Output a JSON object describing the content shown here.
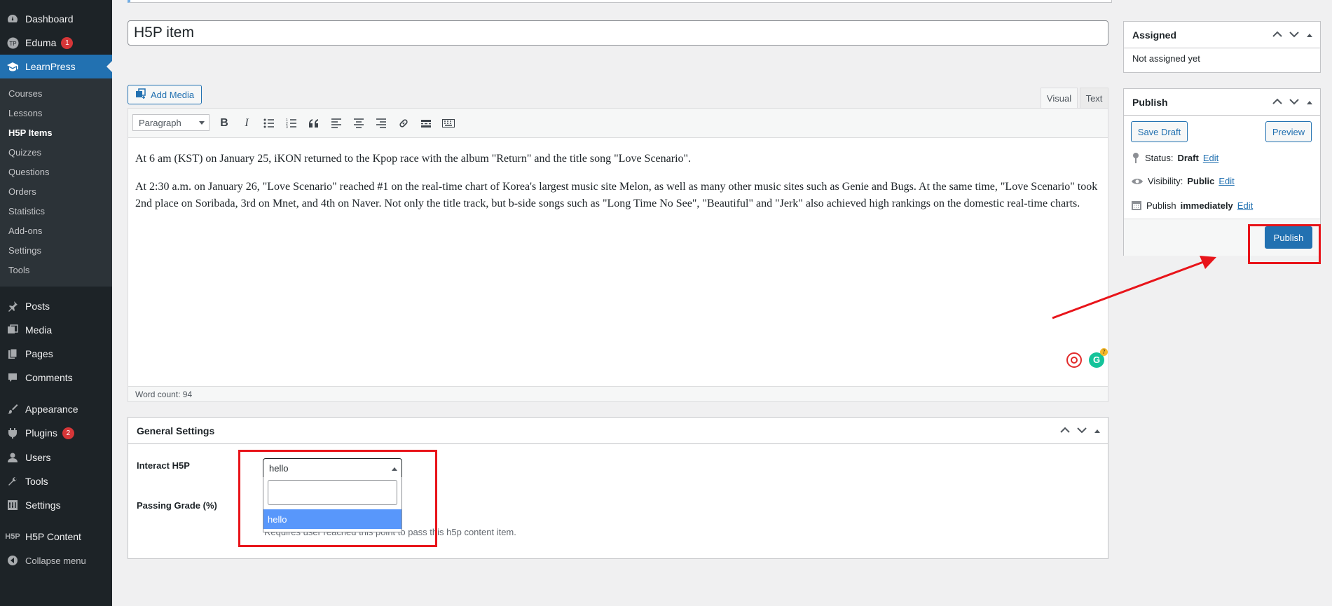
{
  "sidebar": {
    "top": [
      {
        "label": "Dashboard",
        "icon": "dashboard-icon"
      },
      {
        "label": "Eduma",
        "icon": "eduma-icon",
        "badge": "1"
      },
      {
        "label": "LearnPress",
        "icon": "graduation-cap-icon"
      }
    ],
    "submenu": [
      "Courses",
      "Lessons",
      "H5P Items",
      "Quizzes",
      "Questions",
      "Orders",
      "Statistics",
      "Add-ons",
      "Settings",
      "Tools"
    ],
    "bottom": [
      {
        "label": "Posts",
        "icon": "pin-icon"
      },
      {
        "label": "Media",
        "icon": "media-icon"
      },
      {
        "label": "Pages",
        "icon": "pages-icon"
      },
      {
        "label": "Comments",
        "icon": "comments-icon"
      },
      {
        "label": "Appearance",
        "icon": "brush-icon"
      },
      {
        "label": "Plugins",
        "icon": "plugin-icon",
        "badge": "2"
      },
      {
        "label": "Users",
        "icon": "users-icon"
      },
      {
        "label": "Tools",
        "icon": "wrench-icon"
      },
      {
        "label": "Settings",
        "icon": "settings-icon"
      },
      {
        "label": "H5P Content",
        "icon": "h5p-icon",
        "icon_text": "H5P"
      },
      {
        "label": "Collapse menu",
        "icon": "collapse-icon"
      }
    ]
  },
  "editor": {
    "title": "H5P item",
    "add_media": "Add Media",
    "tab_visual": "Visual",
    "tab_text": "Text",
    "format": "Paragraph",
    "paragraphs": [
      "At 6 am (KST) on January 25, iKON returned to the Kpop race with the album \"Return\" and the title song \"Love Scenario\".",
      "At 2:30 a.m. on January 26, \"Love Scenario\" reached #1 on the real-time chart of Korea's largest music site Melon, as well as many other music sites such as Genie and Bugs. At the same time, \"Love Scenario\" took 2nd place on Soribada, 3rd on Mnet, and 4th on Naver. Not only the title track, but b-side songs such as \"Long Time No See\", \"Beautiful\" and \"Jerk\" also achieved high rankings on the domestic real-time charts."
    ],
    "word_count": "Word count: 94",
    "grammarly_badge": "7"
  },
  "assigned": {
    "title": "Assigned",
    "text": "Not assigned yet"
  },
  "publish": {
    "title": "Publish",
    "save_draft": "Save Draft",
    "preview": "Preview",
    "status_label": "Status:",
    "status_value": "Draft",
    "visibility_label": "Visibility:",
    "visibility_value": "Public",
    "publish_label": "Publish",
    "publish_value": "immediately",
    "edit": "Edit",
    "publish_button": "Publish"
  },
  "general_settings": {
    "title": "General Settings",
    "interact_label": "Interact H5P",
    "selected": "hello",
    "option": "hello",
    "passing_label": "Passing Grade (%)",
    "description": "Requires user reached this point to pass this h5p content item."
  },
  "colors": {
    "accent": "#2271b1",
    "sidebar_bg": "#1d2327",
    "annotation": "#e8141a",
    "highlight_option": "#5897fb"
  }
}
